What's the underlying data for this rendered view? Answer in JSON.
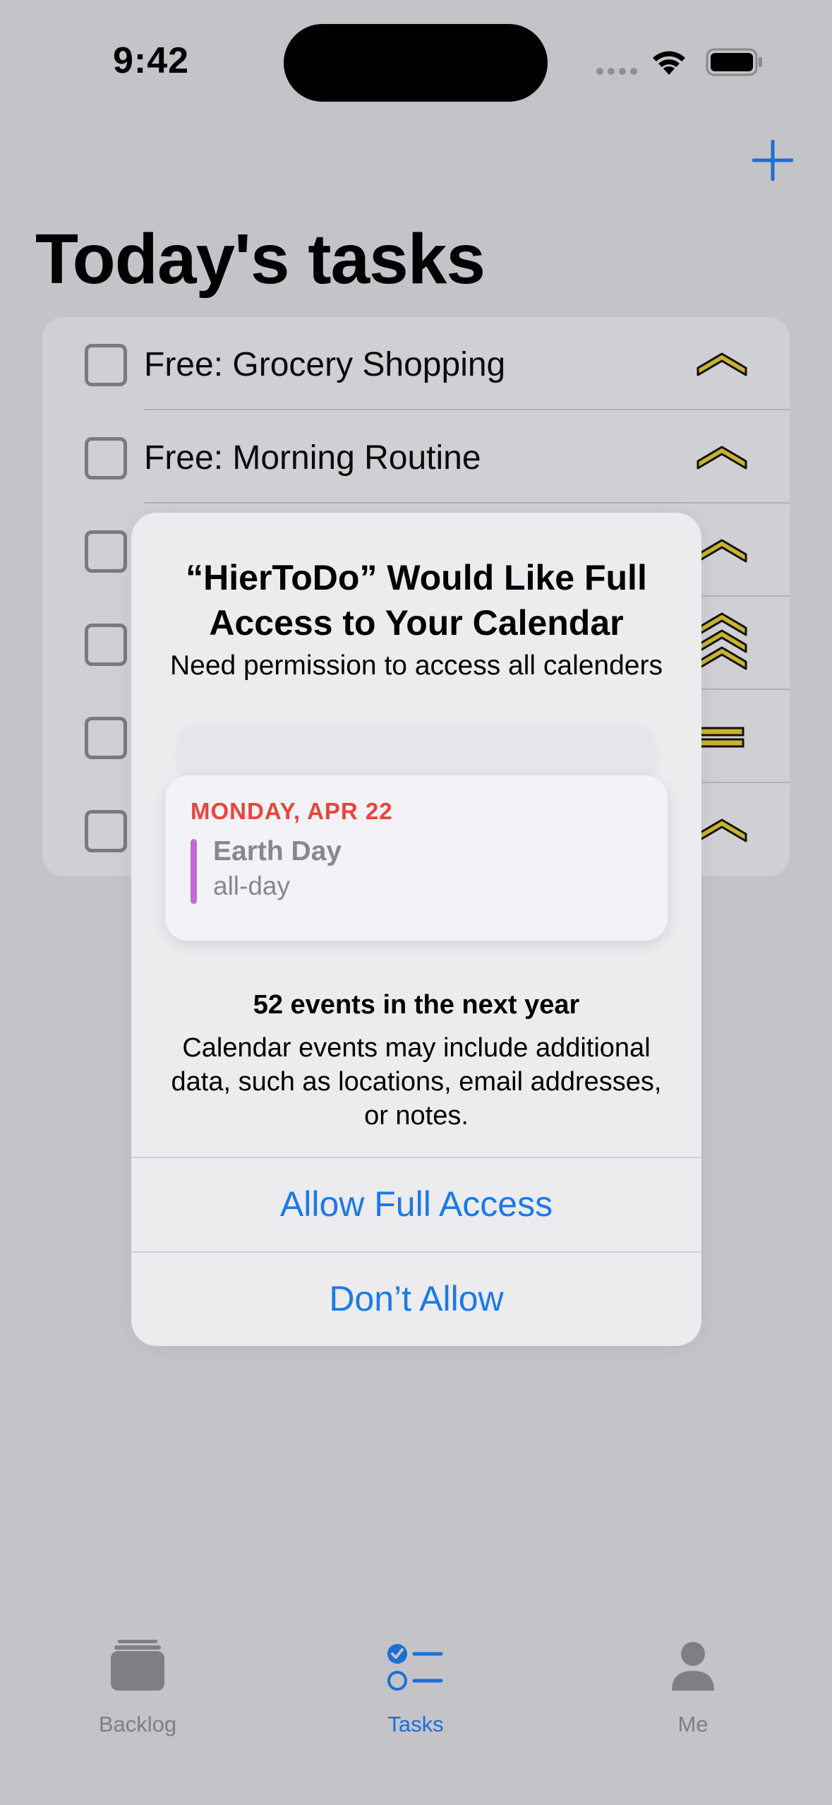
{
  "status_bar": {
    "time": "9:42"
  },
  "header": {
    "title": "Today's tasks"
  },
  "tasks": [
    {
      "label": "Free: Grocery Shopping",
      "priority": "medium-icon"
    },
    {
      "label": "Free: Morning Routine",
      "priority": "medium-icon"
    },
    {
      "label": "",
      "priority": "medium-icon"
    },
    {
      "label": "",
      "priority": "highest-icon"
    },
    {
      "label": "",
      "priority": "normal-icon"
    },
    {
      "label": "",
      "priority": "medium-icon"
    }
  ],
  "alert": {
    "title": "“HierToDo” Would Like Full Access to Your Calendar",
    "message": "Need permission to access all calenders",
    "calendar_preview": {
      "date": "MONDAY, APR 22",
      "event_name": "Earth Day",
      "event_time": "all-day"
    },
    "event_count": "52 events in the next year",
    "description": "Calendar events may include additional data, such as locations, email addresses, or notes.",
    "allow_label": "Allow Full Access",
    "deny_label": "Don’t Allow"
  },
  "tab_bar": {
    "tabs": [
      {
        "label": "Backlog",
        "icon": "tray-stack-icon",
        "active": false
      },
      {
        "label": "Tasks",
        "icon": "checklist-icon",
        "active": true
      },
      {
        "label": "Me",
        "icon": "person-icon",
        "active": false
      }
    ]
  },
  "colors": {
    "accent": "#1a7ae8",
    "calendar_date": "#e9443a",
    "event_bar": "#c06ad8",
    "priority_fill": "#c9b22e"
  }
}
